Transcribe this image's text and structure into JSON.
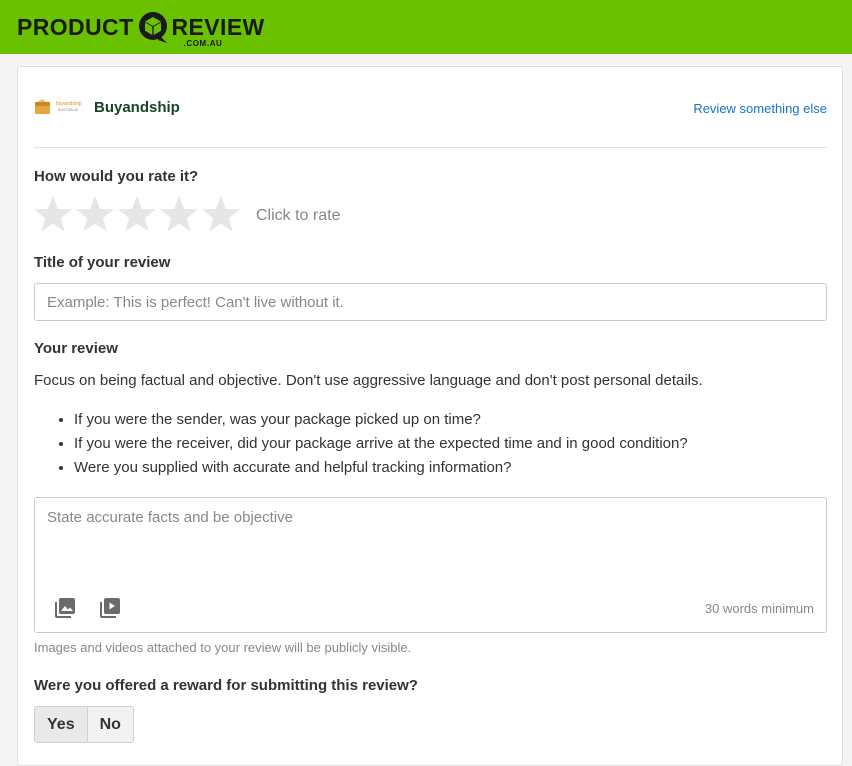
{
  "brand": {
    "left": "PRODUCT",
    "right": "REVIEW",
    "sub": ".COM.AU"
  },
  "business": {
    "name": "Buyandship",
    "logo_text": "buyandship",
    "logo_sub": "AUSTRALIA",
    "review_else_label": "Review something else"
  },
  "rating": {
    "question": "How would you rate it?",
    "star_count": 5,
    "selected": 0,
    "hint": "Click to rate"
  },
  "title_field": {
    "label": "Title of your review",
    "value": "",
    "placeholder": "Example: This is perfect! Can't live without it."
  },
  "review": {
    "label": "Your review",
    "guidance": "Focus on being factual and objective. Don't use aggressive language and don't post personal details.",
    "prompts": [
      "If you were the sender, was your package picked up on time?",
      "If you were the receiver, did your package arrive at the expected time and in good condition?",
      "Were you supplied with accurate and helpful tracking information?"
    ],
    "value": "",
    "placeholder": "State accurate facts and be objective",
    "add_image_icon": "image-icon",
    "add_video_icon": "video-icon",
    "min_words": "30 words minimum",
    "public_note": "Images and videos attached to your review will be publicly visible."
  },
  "reward": {
    "question": "Were you offered a reward for submitting this review?",
    "yes_label": "Yes",
    "no_label": "No"
  },
  "colors": {
    "brand_green": "#6ac100",
    "link_blue": "#1a73c8",
    "star_empty": "#e6e6e6"
  }
}
